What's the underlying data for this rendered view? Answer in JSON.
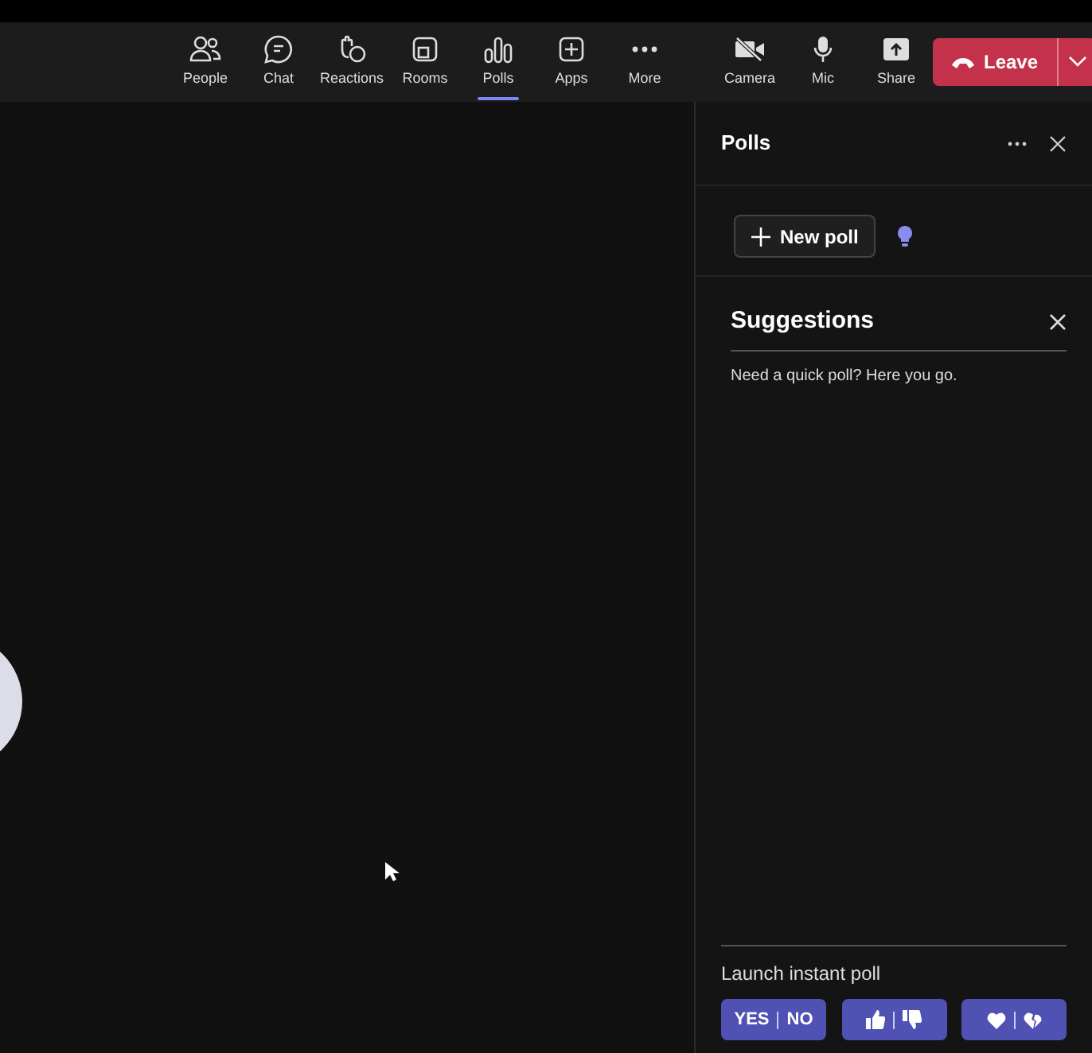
{
  "toolbar": {
    "items": [
      {
        "label": "People",
        "kind": "people",
        "selected": false
      },
      {
        "label": "Chat",
        "kind": "chat",
        "selected": false
      },
      {
        "label": "Reactions",
        "kind": "reactions",
        "selected": false
      },
      {
        "label": "Rooms",
        "kind": "rooms",
        "selected": false
      },
      {
        "label": "Polls",
        "kind": "polls",
        "selected": true
      },
      {
        "label": "Apps",
        "kind": "apps",
        "selected": false
      },
      {
        "label": "More",
        "kind": "more",
        "selected": false
      }
    ],
    "devices": [
      {
        "label": "Camera",
        "kind": "camera"
      },
      {
        "label": "Mic",
        "kind": "mic"
      },
      {
        "label": "Share",
        "kind": "share"
      }
    ],
    "leave_button": "Leave"
  },
  "panel": {
    "title": "Polls",
    "new_poll_button": "New poll",
    "suggestions": {
      "title": "Suggestions",
      "text": "Need a quick poll? Here you go."
    },
    "instant_poll": {
      "label": "Launch instant poll",
      "buttons": [
        {
          "kind": "text",
          "left": "YES",
          "right": "NO"
        },
        {
          "kind": "thumbs"
        },
        {
          "kind": "hearts"
        }
      ]
    }
  }
}
